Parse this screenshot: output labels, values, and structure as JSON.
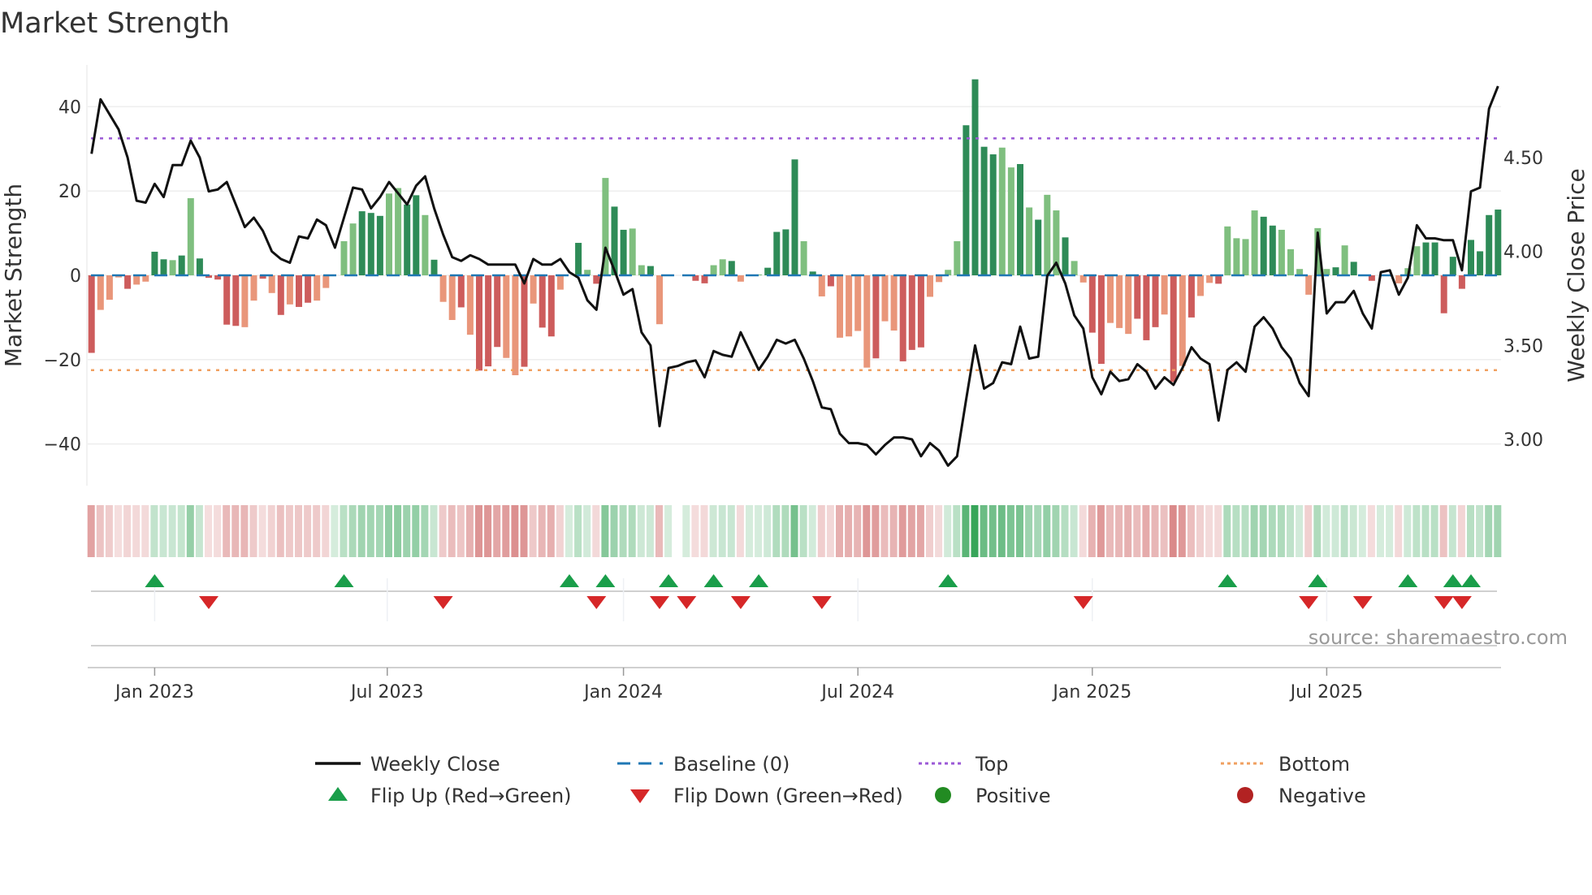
{
  "title": "Market Strength",
  "source": "source: sharemaestro.com",
  "colors": {
    "pos_dark": "#2e8b57",
    "pos_light": "#7fbf7f",
    "neg_dark": "#cd5c5c",
    "neg_light": "#e9967a",
    "line": "#111111",
    "baseline": "#1f77b4",
    "top": "#9b59d6",
    "bottom": "#f0a060",
    "flip_up": "#1a9e4a",
    "flip_down": "#d62728",
    "positive": "#228b22",
    "negative": "#b22222"
  },
  "legend": {
    "weekly_close": "Weekly Close",
    "baseline": "Baseline (0)",
    "top": "Top",
    "bottom": "Bottom",
    "flip_up": "Flip Up (Red→Green)",
    "flip_down": "Flip Down (Green→Red)",
    "positive": "Positive",
    "negative": "Negative"
  },
  "chart_data": {
    "type": "bar",
    "title": "Market Strength",
    "ylabel": "Market Strength",
    "y2label": "Weekly Close Price",
    "ylim": [
      -50,
      50
    ],
    "y2lim": [
      2.78,
      4.96
    ],
    "yticks": [
      "40",
      "20",
      "0",
      "−20",
      "−40"
    ],
    "ytick_values": [
      40,
      20,
      0,
      -20,
      -40
    ],
    "y2ticks": [
      "4.50",
      "4.00",
      "3.50",
      "3.00"
    ],
    "y2tick_values": [
      4.5,
      4.0,
      3.5,
      3.0
    ],
    "xticks": [
      "Jan 2023",
      "Jul 2023",
      "Jan 2024",
      "Jul 2024",
      "Jan 2025",
      "Jul 2025"
    ],
    "xtick_week_index": [
      7,
      32.8,
      59,
      85,
      111,
      137
    ],
    "top_level": 32.5,
    "bottom_level": -22.5,
    "baseline": 0,
    "strength": [
      -18.4,
      -8.2,
      -5.8,
      -0.5,
      -3.2,
      -2.2,
      -1.5,
      5.6,
      3.8,
      3.6,
      4.7,
      18.3,
      4.0,
      -0.6,
      -1.0,
      -11.7,
      -12,
      -12.3,
      -6,
      -0.8,
      -4.2,
      -9.4,
      -6.9,
      -7.5,
      -6.5,
      -6.0,
      -3.0,
      0,
      8.1,
      12.3,
      15.2,
      14.8,
      14.1,
      19.4,
      20.7,
      16.8,
      19.0,
      14.3,
      3.7,
      -6.3,
      -10.6,
      -7.6,
      -14.1,
      -22.6,
      -21.6,
      -17,
      -19.6,
      -23.7,
      -21.7,
      -6.7,
      -12.4,
      -14.5,
      -3.4,
      0,
      7.7,
      1.3,
      -2,
      23.1,
      16.3,
      10.8,
      11.1,
      2.4,
      2.2,
      -11.6,
      0,
      0,
      0,
      -1.3,
      -1.9,
      2.4,
      3.8,
      3.4,
      -1.5,
      0,
      0.2,
      1.8,
      10.3,
      10.9,
      27.5,
      8.1,
      0.9,
      -5,
      -2.6,
      -14.8,
      -14.5,
      -13.2,
      -21.9,
      -19.7,
      -10.9,
      -13.1,
      -20.4,
      -17.7,
      -17.1,
      -5.1,
      -1.6,
      1.3,
      8.1,
      35.6,
      46.5,
      30.5,
      28.7,
      30.3,
      25.6,
      26.4,
      16.1,
      13.2,
      19.1,
      15.4,
      9.0,
      3.4,
      -1.7,
      -13.6,
      -21,
      -11.3,
      -12.5,
      -13.9,
      -10.3,
      -15.4,
      -12.3,
      -9.3,
      -25.3,
      -21.5,
      -10,
      -4.9,
      -1.8,
      -2,
      11.6,
      8.8,
      8.6,
      15.4,
      13.9,
      11.8,
      10.8,
      6.2,
      1.5,
      -4.6,
      11.2,
      1.5,
      1.9,
      7.1,
      3.2,
      0,
      -1.3,
      0,
      0,
      -1.9,
      1.7,
      6.9,
      7.8,
      7.8,
      -9,
      4.4,
      -3.2,
      8.4,
      5.7,
      14.3,
      15.6
    ],
    "shade": "dlldlllddldldddddlldldldllllddd",
    "shade_full": "dllldllddldldddddlldldlddllllldddllddldlldldddlldlddlldldlddlldllddddlldldlddddldldlllldlldddllllddddlldldlldllddllldddldldlldllllddlllllldldddlllllddddddddddldl",
    "weekly_close": [
      4.52,
      4.81,
      4.73,
      4.65,
      4.5,
      4.27,
      4.26,
      4.36,
      4.29,
      4.46,
      4.46,
      4.59,
      4.5,
      4.32,
      4.33,
      4.37,
      4.25,
      4.13,
      4.18,
      4.11,
      4.0,
      3.96,
      3.94,
      4.08,
      4.07,
      4.17,
      4.14,
      4.02,
      4.18,
      4.34,
      4.33,
      4.23,
      4.29,
      4.37,
      4.31,
      4.25,
      4.35,
      4.4,
      4.23,
      4.09,
      3.97,
      3.95,
      3.98,
      3.96,
      3.93,
      3.93,
      3.93,
      3.93,
      3.83,
      3.96,
      3.93,
      3.93,
      3.96,
      3.89,
      3.86,
      3.74,
      3.69,
      4.02,
      3.9,
      3.77,
      3.8,
      3.57,
      3.5,
      3.07,
      3.38,
      3.39,
      3.41,
      3.42,
      3.33,
      3.47,
      3.45,
      3.44,
      3.57,
      3.47,
      3.37,
      3.44,
      3.53,
      3.51,
      3.53,
      3.43,
      3.31,
      3.17,
      3.16,
      3.03,
      2.98,
      2.98,
      2.97,
      2.92,
      2.97,
      3.01,
      3.01,
      3.0,
      2.91,
      2.98,
      2.94,
      2.86,
      2.91,
      3.21,
      3.5,
      3.27,
      3.3,
      3.41,
      3.4,
      3.6,
      3.43,
      3.44,
      3.87,
      3.94,
      3.83,
      3.66,
      3.59,
      3.33,
      3.24,
      3.36,
      3.31,
      3.32,
      3.4,
      3.36,
      3.27,
      3.33,
      3.29,
      3.38,
      3.49,
      3.43,
      3.4,
      3.1,
      3.37,
      3.41,
      3.36,
      3.6,
      3.65,
      3.59,
      3.49,
      3.43,
      3.3,
      3.23,
      4.1,
      3.67,
      3.73,
      3.73,
      3.79,
      3.67,
      3.59,
      3.89,
      3.9,
      3.77,
      3.86,
      4.14,
      4.07,
      4.07,
      4.06,
      4.06,
      3.9,
      4.32,
      4.34,
      4.76,
      4.88
    ],
    "flip_up_week_index": [
      7,
      28,
      53,
      57,
      64,
      69,
      74,
      95,
      126,
      136,
      146,
      151,
      153
    ],
    "flip_down_week_index": [
      13,
      39,
      56,
      63,
      66,
      72,
      81,
      110,
      135,
      141,
      150,
      152
    ],
    "legend_position": "bottom"
  }
}
